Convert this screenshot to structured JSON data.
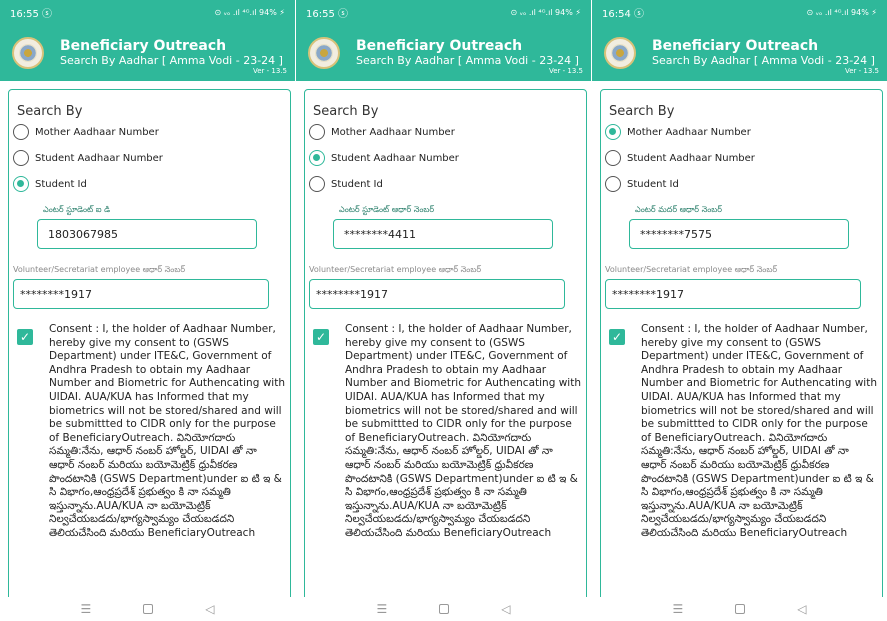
{
  "screens": [
    {
      "status_time": "16:55 ⓢ",
      "status_right": "⊙ ᵥₒ .ıl ⁴ᴳ.ıl 94% ⚡",
      "app_title": "Beneficiary Outreach",
      "app_subtitle": "Search By Aadhar [ Amma Vodi - 23-24 ]",
      "version": "Ver - 13.5",
      "search_by": "Search By",
      "options": [
        "Mother Aadhaar Number",
        "Student Aadhaar Number",
        "Student Id"
      ],
      "selected": 2,
      "field_label": "ఎంటర్ స్టూడెంట్ ఐ డి",
      "field_value": "1803067985",
      "volunteer_label": "Volunteer/Secretariat employee  ఆధార్ నెంబర్",
      "volunteer_value": "********1917",
      "consent_text": "Consent : I, the holder of Aadhaar Number, hereby give my consent to (GSWS Department) under ITE&C, Government of Andhra Pradesh to obtain my Aadhaar Number and Biometric for Authencating with UIDAI. AUA/KUA has Informed that my biometrics will not be stored/shared and will be submittted to CIDR only for the purpose of BeneficiaryOutreach. వినియోగదారు సమ్మతి:నేను, ఆధార్ నంబర్ హోల్డర్, UIDAI తో నా ఆధార్ నంబర్ మరియు బయోమెట్రిక్ ధ్రువీకరణ పొందటానికి (GSWS Department)under ఐ టి ఇ & సి విభాగం,ఆంధ్రప్రదేశ్ ప్రభుత్వం కి నా సమ్మతి ఇస్తున్నాను.AUA/KUA నా బయోమెట్రిక్ నిల్వచేయబడదు/భాగ్యస్వామ్యం చేయబడదని తెలియచేసింది మరియు BeneficiaryOutreach"
    },
    {
      "status_time": "16:55 ⓢ",
      "status_right": "⊙ ᵥₒ .ıl ⁴ᴳ.ıl 94% ⚡",
      "app_title": "Beneficiary Outreach",
      "app_subtitle": "Search By Aadhar [ Amma Vodi - 23-24 ]",
      "version": "Ver - 13.5",
      "search_by": "Search By",
      "options": [
        "Mother Aadhaar Number",
        "Student Aadhaar Number",
        "Student Id"
      ],
      "selected": 1,
      "field_label": "ఎంటర్ స్టూడెంట్ ఆధార్ నెంబర్",
      "field_value": "********4411",
      "volunteer_label": "Volunteer/Secretariat employee  ఆధార్ నెంబర్",
      "volunteer_value": "********1917",
      "consent_text": "Consent : I, the holder of Aadhaar Number, hereby give my consent to (GSWS Department) under ITE&C, Government of Andhra Pradesh to obtain my Aadhaar Number and Biometric for Authencating with UIDAI. AUA/KUA has Informed that my biometrics will not be stored/shared and will be submittted to CIDR only for the purpose of BeneficiaryOutreach. వినియోగదారు సమ్మతి:నేను, ఆధార్ నంబర్ హోల్డర్, UIDAI తో నా ఆధార్ నంబర్ మరియు బయోమెట్రిక్ ధ్రువీకరణ పొందటానికి (GSWS Department)under ఐ టి ఇ & సి విభాగం,ఆంధ్రప్రదేశ్ ప్రభుత్వం కి నా సమ్మతి ఇస్తున్నాను.AUA/KUA నా బయోమెట్రిక్ నిల్వచేయబడదు/భాగ్యస్వామ్యం చేయబడదని తెలియచేసింది మరియు BeneficiaryOutreach"
    },
    {
      "status_time": "16:54 ⓢ",
      "status_right": "⊙ ᵥₒ .ıl ⁴ᴳ.ıl 94% ⚡",
      "app_title": "Beneficiary Outreach",
      "app_subtitle": "Search By Aadhar [ Amma Vodi - 23-24 ]",
      "version": "Ver - 13.5",
      "search_by": "Search By",
      "options": [
        "Mother Aadhaar Number",
        "Student Aadhaar Number",
        "Student Id"
      ],
      "selected": 0,
      "field_label": "ఎంటర్ మదర్ ఆధార్ నెంబర్",
      "field_value": "********7575",
      "volunteer_label": "Volunteer/Secretariat employee  ఆధార్ నెంబర్",
      "volunteer_value": "********1917",
      "consent_text": "Consent : I, the holder of Aadhaar Number, hereby give my consent to (GSWS Department) under ITE&C, Government of Andhra Pradesh to obtain my Aadhaar Number and Biometric for Authencating with UIDAI. AUA/KUA has Informed that my biometrics will not be stored/shared and will be submittted to CIDR only for the purpose of BeneficiaryOutreach. వినియోగదారు సమ్మతి:నేను, ఆధార్ నంబర్ హోల్డర్, UIDAI తో నా ఆధార్ నంబర్ మరియు బయోమెట్రిక్ ధ్రువీకరణ పొందటానికి (GSWS Department)under ఐ టి ఇ & సి విభాగం,ఆంధ్రప్రదేశ్ ప్రభుత్వం కి నా సమ్మతి ఇస్తున్నాను.AUA/KUA నా బయోమెట్రిక్ నిల్వచేయబడదు/భాగ్యస్వామ్యం చేయబడదని తెలియచేసింది మరియు BeneficiaryOutreach"
    }
  ],
  "nav": {
    "menu": "☰",
    "back": "◁"
  },
  "colors": {
    "accent": "#2fb89a"
  }
}
